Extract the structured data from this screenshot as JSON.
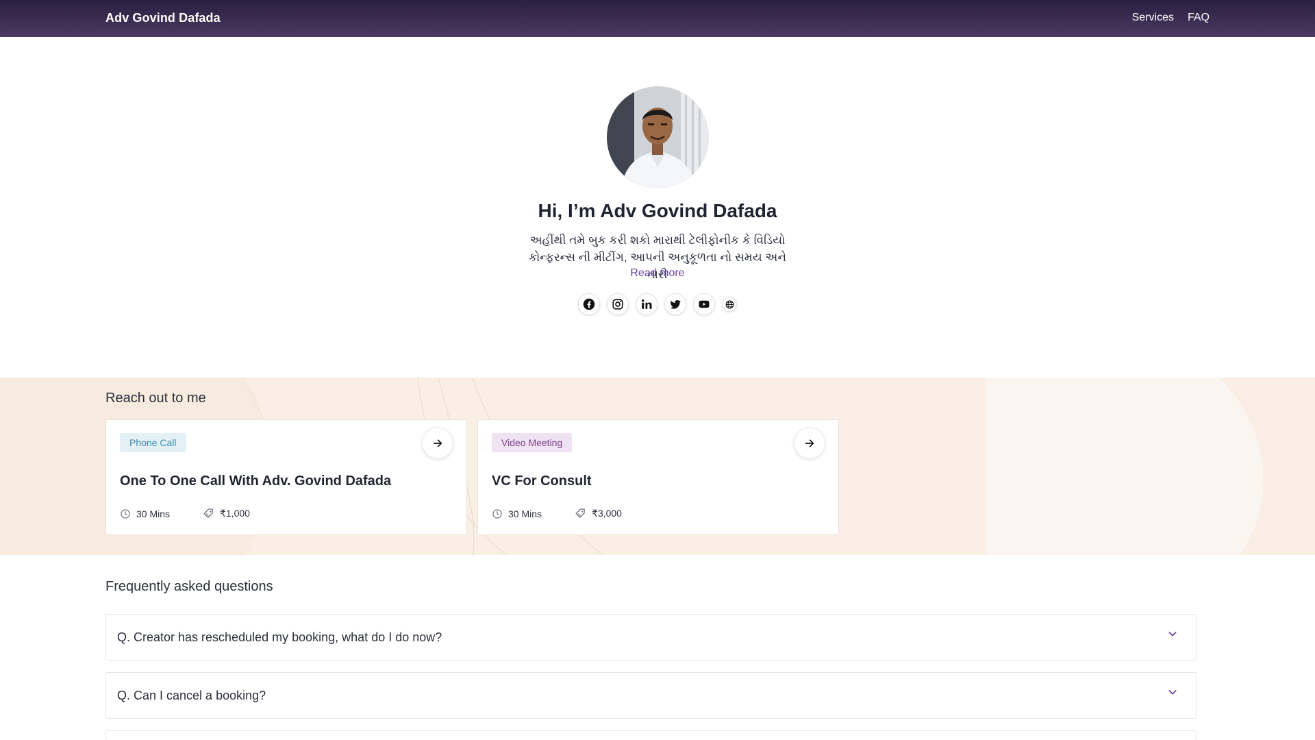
{
  "header": {
    "brand": "Adv Govind Dafada",
    "nav": [
      {
        "label": "Services"
      },
      {
        "label": "FAQ"
      }
    ]
  },
  "hero": {
    "title": "Hi, I’m Adv Govind Dafada",
    "bio_line1": "અહીંથી તમે બુક કરી શકો મારાથી ટેલીફોનીક કે વિડિયો",
    "bio_line2": "કોન્ફરન્સ ની મીટીંગ, આપની અનુકૂળતા નો સમય અને તારી",
    "read_more": "Read more",
    "socials": [
      "facebook-icon",
      "instagram-icon",
      "linkedin-icon",
      "twitter-icon",
      "youtube-icon",
      "globe-icon"
    ]
  },
  "services": {
    "title": "Reach out to me",
    "cards": [
      {
        "chip": "Phone Call",
        "title": "One To One Call With Adv. Govind Dafada",
        "duration": "30 Mins",
        "price": "₹1,000"
      },
      {
        "chip": "Video Meeting",
        "title": "VC For Consult",
        "duration": "30 Mins",
        "price": "₹3,000"
      }
    ]
  },
  "faq": {
    "title": "Frequently asked questions",
    "items": [
      {
        "question": "Q. Creator has rescheduled my booking, what do I do now?"
      },
      {
        "question": "Q. Can I cancel a booking?"
      }
    ]
  },
  "colors": {
    "nav_bg": "#3a2c50",
    "accent": "#6b3fa0",
    "band_bg": "#f9efe5"
  }
}
